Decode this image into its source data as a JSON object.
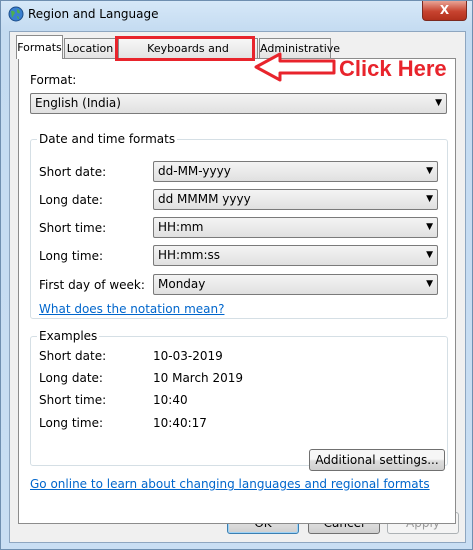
{
  "window": {
    "title": "Region and Language",
    "close_label": "X"
  },
  "tabs": [
    {
      "label": "Formats",
      "active": true
    },
    {
      "label": "Location",
      "active": false
    },
    {
      "label": "Keyboards and Languages",
      "active": false
    },
    {
      "label": "Administrative",
      "active": false
    }
  ],
  "format": {
    "label": "Format:",
    "value": "English (India)"
  },
  "date_time_formats": {
    "title": "Date and time formats",
    "rows": [
      {
        "label": "Short date:",
        "value": "dd-MM-yyyy"
      },
      {
        "label": "Long date:",
        "value": "dd MMMM yyyy"
      },
      {
        "label": "Short time:",
        "value": "HH:mm"
      },
      {
        "label": "Long time:",
        "value": "HH:mm:ss"
      },
      {
        "label": "First day of week:",
        "value": "Monday"
      }
    ],
    "notation_link": "What does the notation mean?"
  },
  "examples": {
    "title": "Examples",
    "rows": [
      {
        "label": "Short date:",
        "value": "10-03-2019"
      },
      {
        "label": "Long date:",
        "value": "10 March 2019"
      },
      {
        "label": "Short time:",
        "value": "10:40"
      },
      {
        "label": "Long time:",
        "value": "10:40:17"
      }
    ]
  },
  "additional_settings_label": "Additional settings...",
  "online_link": "Go online to learn about changing languages and regional formats",
  "footer": {
    "ok": "OK",
    "cancel": "Cancel",
    "apply": "Apply"
  },
  "annotation": {
    "text": "Click Here",
    "color": "#e8242c"
  },
  "icons": {
    "title": "globe-icon",
    "dropdown": "chevron-down-icon"
  }
}
